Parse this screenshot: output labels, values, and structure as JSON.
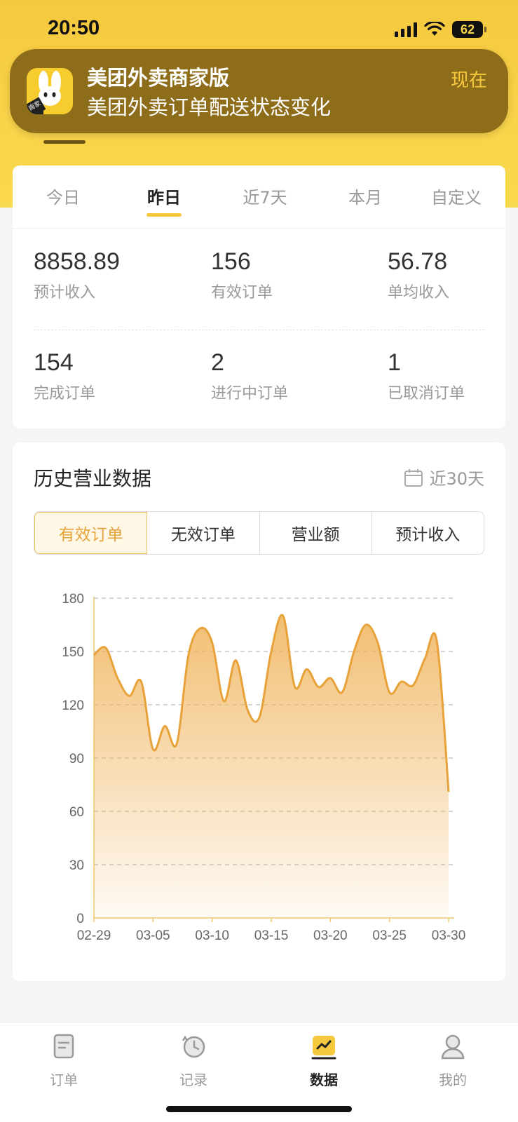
{
  "status_bar": {
    "time": "20:50",
    "battery": "62"
  },
  "notification": {
    "app_name": "美团外卖商家版",
    "message": "美团外卖订单配送状态变化",
    "time": "现在",
    "icon_badge": "商家"
  },
  "period_tabs": [
    {
      "label": "今日",
      "active": false
    },
    {
      "label": "昨日",
      "active": true
    },
    {
      "label": "近7天",
      "active": false
    },
    {
      "label": "本月",
      "active": false
    },
    {
      "label": "自定义",
      "active": false
    }
  ],
  "stats": [
    {
      "value": "8858.89",
      "label": "预计收入"
    },
    {
      "value": "156",
      "label": "有效订单"
    },
    {
      "value": "56.78",
      "label": "单均收入"
    },
    {
      "value": "154",
      "label": "完成订单"
    },
    {
      "value": "2",
      "label": "进行中订单"
    },
    {
      "value": "1",
      "label": "已取消订单"
    }
  ],
  "history": {
    "title": "历史营业数据",
    "range_label": "近30天",
    "segments": [
      {
        "label": "有效订单",
        "active": true
      },
      {
        "label": "无效订单",
        "active": false
      },
      {
        "label": "营业额",
        "active": false
      },
      {
        "label": "预计收入",
        "active": false
      }
    ]
  },
  "chart_data": {
    "type": "area",
    "title": "",
    "xlabel": "",
    "ylabel": "",
    "x_ticks": [
      "02-29",
      "03-05",
      "03-10",
      "03-15",
      "03-20",
      "03-25",
      "03-30"
    ],
    "y_ticks": [
      0,
      30,
      60,
      90,
      120,
      150,
      180
    ],
    "ylim": [
      0,
      180
    ],
    "grid": true,
    "line_color": "#e8a23a",
    "fill_color": "#f0b35a",
    "x": [
      "02-29",
      "03-01",
      "03-02",
      "03-03",
      "03-04",
      "03-05",
      "03-06",
      "03-07",
      "03-08",
      "03-09",
      "03-10",
      "03-11",
      "03-12",
      "03-13",
      "03-14",
      "03-15",
      "03-16",
      "03-17",
      "03-18",
      "03-19",
      "03-20",
      "03-21",
      "03-22",
      "03-23",
      "03-24",
      "03-25",
      "03-26",
      "03-27",
      "03-28",
      "03-29",
      "03-30"
    ],
    "series": [
      {
        "values": [
          148,
          152,
          135,
          125,
          133,
          95,
          108,
          98,
          148,
          163,
          155,
          122,
          145,
          117,
          113,
          150,
          170,
          130,
          140,
          130,
          135,
          127,
          150,
          165,
          155,
          127,
          133,
          131,
          146,
          156,
          71
        ]
      }
    ]
  },
  "bottom_nav": [
    {
      "label": "订单",
      "icon": "order-icon",
      "active": false
    },
    {
      "label": "记录",
      "icon": "history-icon",
      "active": false
    },
    {
      "label": "数据",
      "icon": "data-chart-icon",
      "active": true
    },
    {
      "label": "我的",
      "icon": "profile-icon",
      "active": false
    }
  ]
}
